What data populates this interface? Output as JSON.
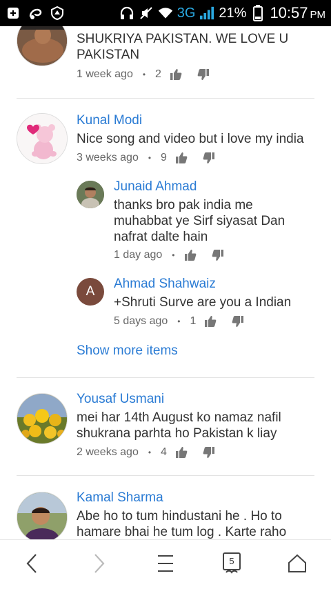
{
  "status_bar": {
    "network": "3G",
    "battery": "21%",
    "time": "10:57",
    "ampm": "PM"
  },
  "comments": [
    {
      "author": "",
      "text": "SHUKRIYA PAKISTAN. WE LOVE U PAKISTAN",
      "time": "1 week ago",
      "likes": "2"
    },
    {
      "author": "Kunal Modi",
      "text": "Nice song and video but i love my india",
      "time": "3 weeks ago",
      "likes": "9",
      "replies": [
        {
          "author": "Junaid Ahmad",
          "text": "thanks bro pak india me muhabbat ye Sirf siyasat Dan nafrat dalte hain",
          "time": "1 day ago"
        },
        {
          "author": "Ahmad Shahwaiz",
          "avatar_letter": "A",
          "text": "+Shruti Surve are you a Indian",
          "time": "5 days ago",
          "likes": "1"
        }
      ],
      "show_more": "Show more items"
    },
    {
      "author": "Yousaf Usmani",
      "text": "mei har 14th August ko namaz nafil shukrana parhta ho Pakistan k liay",
      "time": "2 weeks ago",
      "likes": "4"
    },
    {
      "author": "Kamal Sharma",
      "text": "Abe ho to tum hindustani he . Ho to hamare bhai he tum log . Karte raho",
      "time": "",
      "likes": ""
    }
  ],
  "bottom_nav": {
    "tab_count": "5"
  },
  "colors": {
    "link_blue": "#2a7bd4",
    "text": "#333333",
    "meta": "#666666",
    "status_bar_bg": "#000000",
    "network_blue": "#2aa8e0"
  }
}
